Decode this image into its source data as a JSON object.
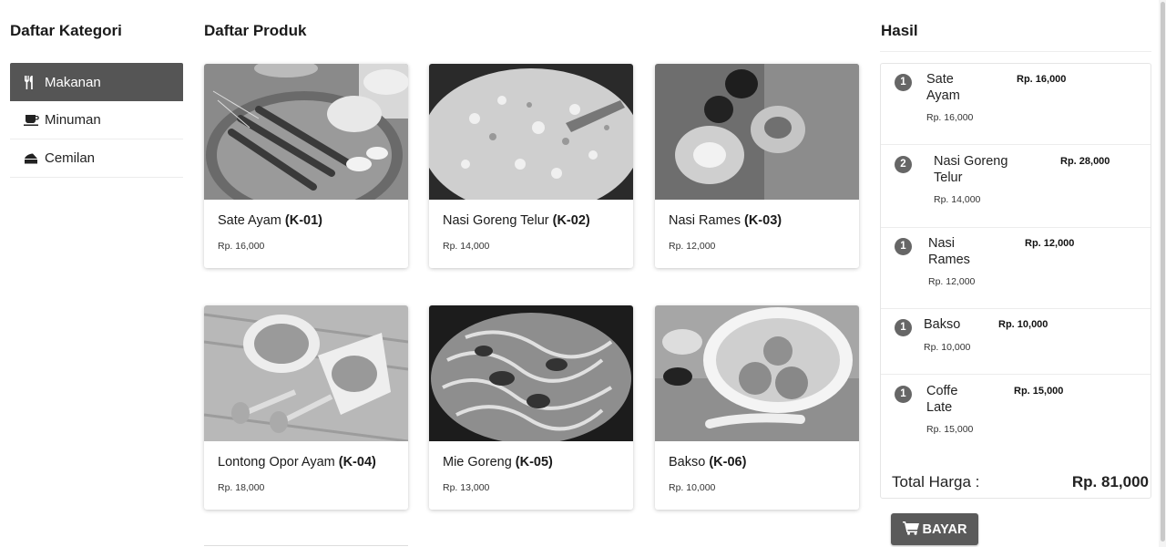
{
  "categories_title": "Daftar Kategori",
  "products_title": "Daftar Produk",
  "result_title": "Hasil",
  "categories": [
    {
      "label": "Makanan",
      "icon": "utensils-icon",
      "active": true
    },
    {
      "label": "Minuman",
      "icon": "coffee-icon",
      "active": false
    },
    {
      "label": "Cemilan",
      "icon": "cheese-icon",
      "active": false
    }
  ],
  "products": [
    {
      "name": "Sate Ayam ",
      "code": "(K-01)",
      "price": "Rp. 16,000",
      "image": "sate-ayam-photo"
    },
    {
      "name": "Nasi Goreng Telur ",
      "code": "(K-02)",
      "price": "Rp. 14,000",
      "image": "nasi-goreng-photo"
    },
    {
      "name": "Nasi Rames ",
      "code": "(K-03)",
      "price": "Rp. 12,000",
      "image": "nasi-rames-photo"
    },
    {
      "name": "Lontong Opor Ayam ",
      "code": "(K-04)",
      "price": "Rp. 18,000",
      "image": "lontong-opor-photo"
    },
    {
      "name": "Mie Goreng ",
      "code": "(K-05)",
      "price": "Rp. 13,000",
      "image": "mie-goreng-photo"
    },
    {
      "name": "Bakso ",
      "code": "(K-06)",
      "price": "Rp. 10,000",
      "image": "bakso-photo"
    }
  ],
  "cart": [
    {
      "qty": "1",
      "name": "Sate\nAyam",
      "unit": "Rp. 16,000",
      "total": "Rp. 16,000"
    },
    {
      "qty": "2",
      "name": "Nasi Goreng\nTelur",
      "unit": "Rp. 14,000",
      "total": "Rp. 28,000"
    },
    {
      "qty": "1",
      "name": "Nasi\nRames",
      "unit": "Rp. 12,000",
      "total": "Rp. 12,000"
    },
    {
      "qty": "1",
      "name": "Bakso",
      "unit": "Rp. 10,000",
      "total": "Rp. 10,000"
    },
    {
      "qty": "1",
      "name": "Coffe\nLate",
      "unit": "Rp. 15,000",
      "total": "Rp. 15,000"
    }
  ],
  "total_label": "Total Harga :",
  "total_value": "Rp. 81,000",
  "pay_label": "BAYAR",
  "pay_icon": "cart-icon"
}
